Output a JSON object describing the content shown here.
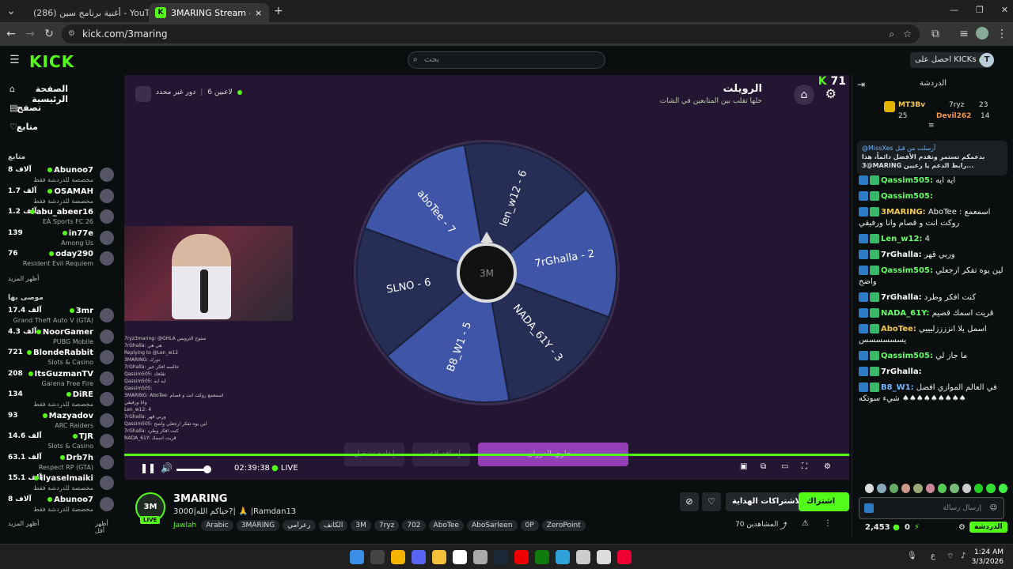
{
  "browser": {
    "tabs": [
      {
        "label": "(286) أغنية برنامج سين - YouTube"
      },
      {
        "label": "3MARING Stream - Watch Live on Kick"
      }
    ],
    "new_tab": "+",
    "url": "kick.com/3maring"
  },
  "kick": {
    "logo": "KICK",
    "search_placeholder": "بحث",
    "get_kicks": "احصل على KICKs",
    "avatar_letter": "T"
  },
  "sidebar": {
    "nav": [
      {
        "label": "الصفحة الرئيسية"
      },
      {
        "label": "تصفح"
      },
      {
        "label": "متابع"
      }
    ],
    "following_title": "متابع",
    "following": [
      {
        "name": "Abunoo7",
        "cat": "مخصصة للدردشة فقط",
        "count": "8 آلاف"
      },
      {
        "name": "OSAMAH",
        "cat": "مخصصة للدردشة فقط",
        "count": "1.7 آلف"
      },
      {
        "name": "abu_abeer16",
        "cat": "EA Sports FC 26",
        "count": "1.2 آلف"
      },
      {
        "name": "in77e",
        "cat": "Among Us",
        "count": "139"
      },
      {
        "name": "oday290",
        "cat": "Resident Evil Requiem",
        "count": "76"
      }
    ],
    "show_more": "أظهر المزيد",
    "recommended_title": "موصى بها",
    "recommended": [
      {
        "name": "3mr",
        "cat": "Grand Theft Auto V (GTA)",
        "count": "17.4 آلف"
      },
      {
        "name": "NoorGamer",
        "cat": "PUBG Mobile",
        "count": "4.3 آلف"
      },
      {
        "name": "BlondeRabbit",
        "cat": "Slots & Casino",
        "count": "721"
      },
      {
        "name": "ItsGuzmanTV",
        "cat": "Garena Free Fire",
        "count": "208"
      },
      {
        "name": "DiRE",
        "cat": "مخصصة للدردشة فقط",
        "count": "134"
      },
      {
        "name": "Mazyadov",
        "cat": "ARC Raiders",
        "count": "93"
      },
      {
        "name": "TJR",
        "cat": "Slots & Casino",
        "count": "14.6 آلف"
      },
      {
        "name": "Drb7h",
        "cat": "Respect RP (GTA)",
        "count": "63.1 آلف"
      },
      {
        "name": "ilyaselmaiki",
        "cat": "مخصصة للدردشة فقط",
        "count": "15.1 آلف"
      },
      {
        "name": "Abunoo7",
        "cat": "مخصصة للدردشة فقط",
        "count": "8 آلاف"
      }
    ],
    "show_more2": "أظهر المزيد",
    "show_less": "أظهر أقل"
  },
  "video": {
    "overlay_title": "الرويلت",
    "overlay_sub": "خلها تقلب بين المتابعين في الشات",
    "kick_count": "71",
    "players": "6 لاعبين",
    "round": "دور غير محدد",
    "wheel_segments": [
      "len_w12 - 6",
      "7rGhalla - 2",
      "NADA_61Y - 3",
      "B8_W1 - 5",
      "SLNO - 6",
      "aboTee - 7"
    ],
    "wheel_center": "3M",
    "btn_restart": "إعادة تشغيل",
    "btn_add": "إضافة لاعب",
    "btn_spin": "جاري الدوران...",
    "mini_chat": [
      "7ryz3maring: @GHLA منتوج الترويس",
      "7rGhalla: هي هي",
      "Replying to @Len_w12",
      "3MARING: دورك",
      "7rGhalla: جالسه افكر خير",
      "Qassim505: تقلعك",
      "Qassim505: ايه ايه",
      "Qassim505:",
      "3MARING: AboTee: اسمعمع روكت انت و قصام",
      "وانا ورفيقي",
      "Len_w12: 4",
      "7rGhalla: وربي قهر",
      "Qassim505: لين يوه تفكر ارجعلي واضح",
      "7rGhalla: كنت افكر وطرد",
      "NADA_61Y: قريت اسمك"
    ],
    "time": "02:39:38",
    "live": "LIVE"
  },
  "channel": {
    "name": "3MARING",
    "title": "حياكم الله|3000?| 🙏 |Ramdan13",
    "category": "Jawlah",
    "tags": [
      "Arabic",
      "3MARING",
      "رعرامي",
      "الكاتف",
      "3M",
      "7ryz",
      "702",
      "AboTee",
      "AboSarleen",
      "0P",
      "ZeroPoint"
    ],
    "follow": "اشتراك",
    "subs": "الاشتراكات الهداية",
    "viewers": "المشاهدين 70",
    "live_badge": "LIVE",
    "avatar_text": "3M"
  },
  "chat": {
    "title": "الدردشة",
    "leaders": [
      {
        "name": "MT3Bv",
        "value": "25"
      },
      {
        "name": "7ryz",
        "value": "23"
      },
      {
        "name": "Devil262",
        "value": "14"
      }
    ],
    "pinned_by": "@MissXes أرسلت من قبل",
    "pinned_text": "بدعمكم تستمر ونقدم الأفضل دائماً، هذا @3MARING رابط الدعم يا رعيين...",
    "messages": [
      {
        "user": "Qassim505:",
        "text": "ايه ايه",
        "color": "#66ff66"
      },
      {
        "user": "Qassim505:",
        "text": "",
        "color": "#66ff66"
      },
      {
        "user": "3MARING:",
        "text": "AboTee : اسمعمع روكت انت و قصام وانا ورفيقي",
        "color": "#f2c94c"
      },
      {
        "user": "Len_w12:",
        "text": "4",
        "color": "#66ff66"
      },
      {
        "user": "7rGhalla:",
        "text": "وربي قهر",
        "color": "#ffffff"
      },
      {
        "user": "Qassim505:",
        "text": "لين يوه تفكر ارجعلي واضح",
        "color": "#66ff66"
      },
      {
        "user": "7rGhalla:",
        "text": "كنت افكر وطرد",
        "color": "#ffffff"
      },
      {
        "user": "NADA_61Y:",
        "text": "قريت اسمك قصيم",
        "color": "#66ff66"
      },
      {
        "user": "AboTee:",
        "text": "اسمل يلا انززززليييي يسسسسسس",
        "color": "#f2c94c"
      },
      {
        "user": "Qassim505:",
        "text": "ما جاز لي",
        "color": "#66ff66"
      },
      {
        "user": "7rGhalla:",
        "text": "",
        "color": "#ffffff"
      },
      {
        "user": "B8_W1:",
        "text": "في العالم الموازي افضل شيء سوتكه ♠♠♠♠♠♠♠♠♠",
        "color": "#6fb6ff"
      }
    ],
    "input_placeholder": "إرسال رسالة",
    "points": "2,453",
    "zero": "0",
    "send": "الدردشة"
  },
  "taskbar": {
    "time": "1:24 AM",
    "date": "3/3/2026",
    "lang": "ع"
  }
}
